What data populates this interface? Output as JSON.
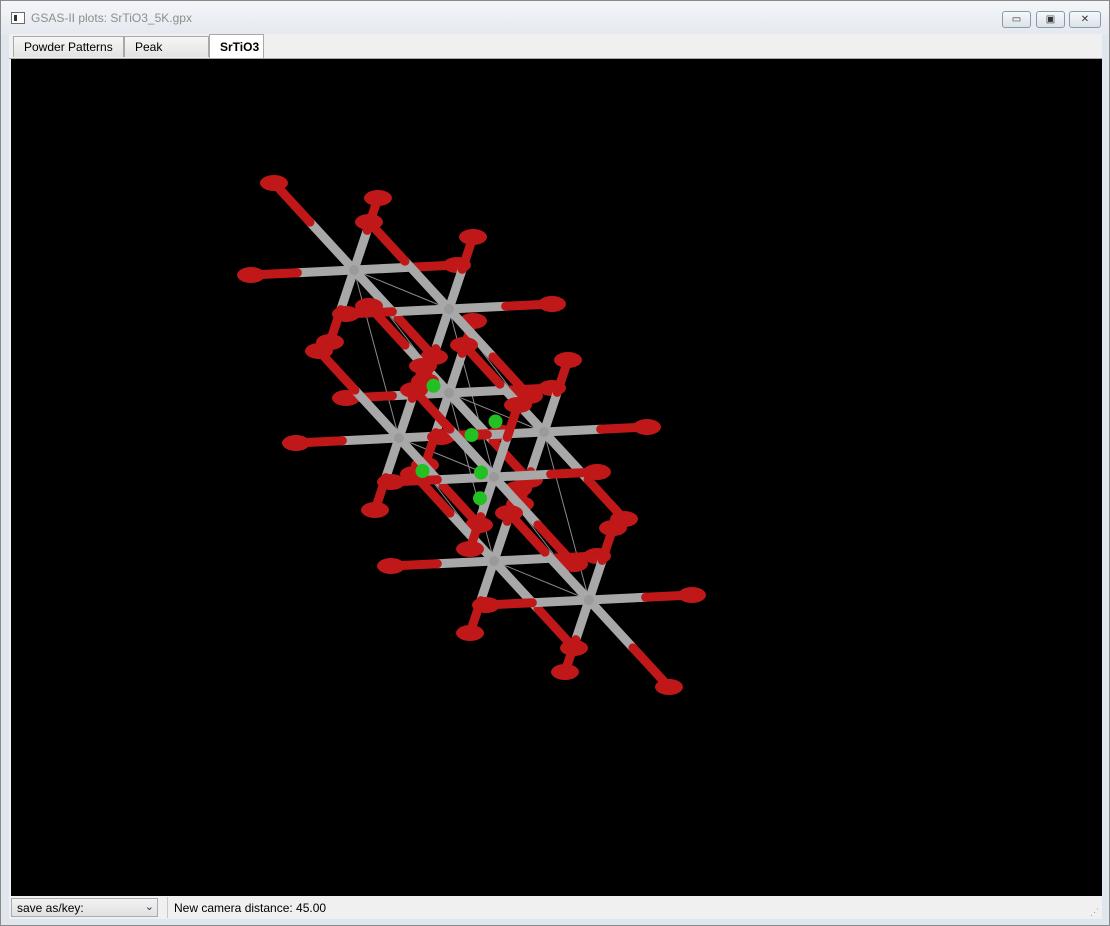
{
  "window": {
    "title": "GSAS-II plots: SrTiO3_5K.gpx",
    "controls": {
      "minimize": "▭",
      "maximize": "▣",
      "close": "✕"
    }
  },
  "tabs": [
    {
      "label": "Powder Patterns",
      "active": false
    },
    {
      "label": "Peak Widths",
      "active": false
    },
    {
      "label": "SrTiO3",
      "active": true
    }
  ],
  "plot": {
    "content": "3D crystal structure view (ball-and-stick)",
    "colors": {
      "background": "#000000",
      "bond": "#a8a8a8",
      "oxygen": "#c01818",
      "strontium": "#22c022",
      "cell_edge": "#8a8a8a"
    }
  },
  "status": {
    "save_select": {
      "value": "save as/key:"
    },
    "message": "New camera distance: 45.00"
  }
}
